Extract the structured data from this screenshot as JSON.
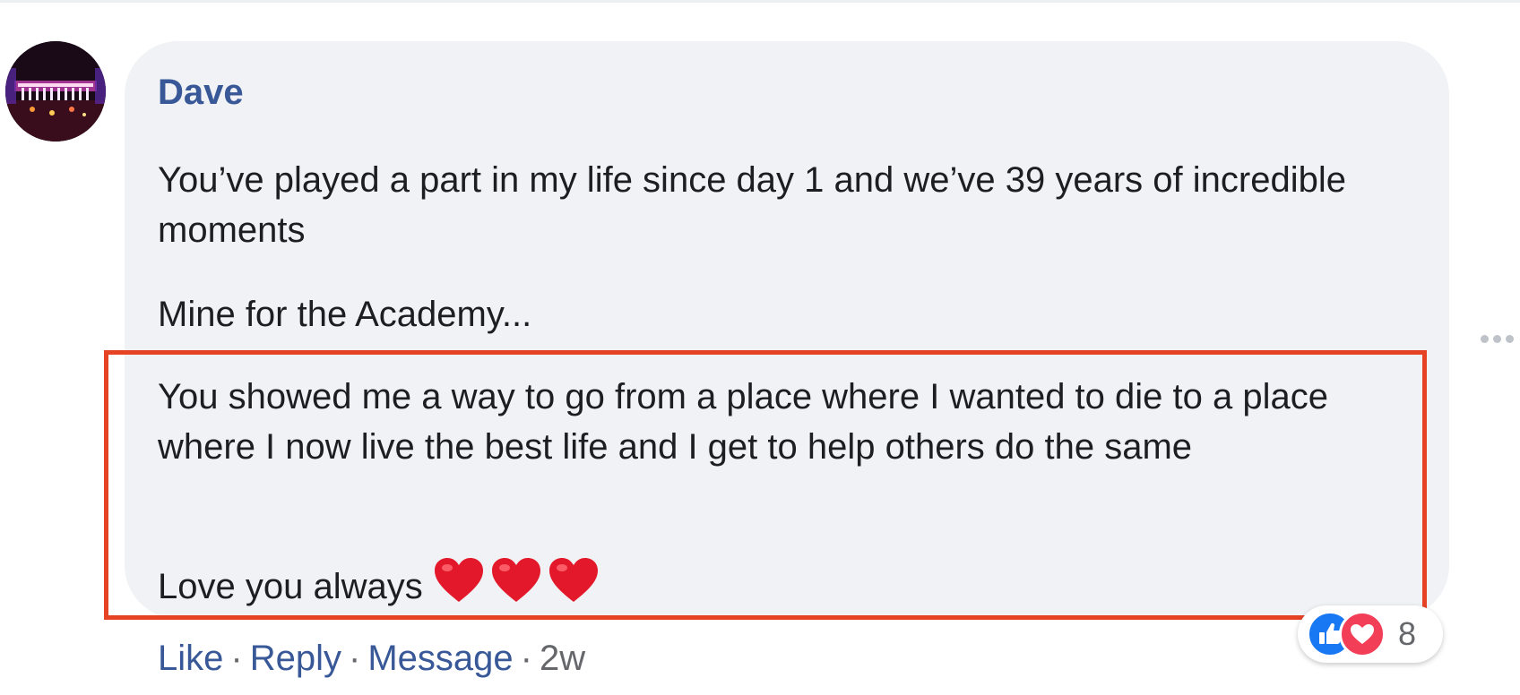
{
  "comment": {
    "author": "Dave",
    "paragraphs": [
      "You’ve played a part in my life since day 1 and we’ve 39 years of incredible moments",
      "Mine for the Academy...",
      "You showed me a way to go from a place where I wanted to die to a place where I now live the best life and I get to help others do the same",
      "Love you always"
    ],
    "emoji": [
      "heart-icon",
      "heart-icon",
      "heart-icon"
    ],
    "actions": {
      "like": "Like",
      "reply": "Reply",
      "message": "Message",
      "separator": "·",
      "time": "2w"
    },
    "reactions": {
      "types": [
        "like-icon",
        "love-icon"
      ],
      "count": "8"
    }
  },
  "colors": {
    "author": "#385898",
    "bubble": "#f0f2f5",
    "highlight": "#e64325",
    "link": "#385898",
    "muted": "#65676b"
  }
}
